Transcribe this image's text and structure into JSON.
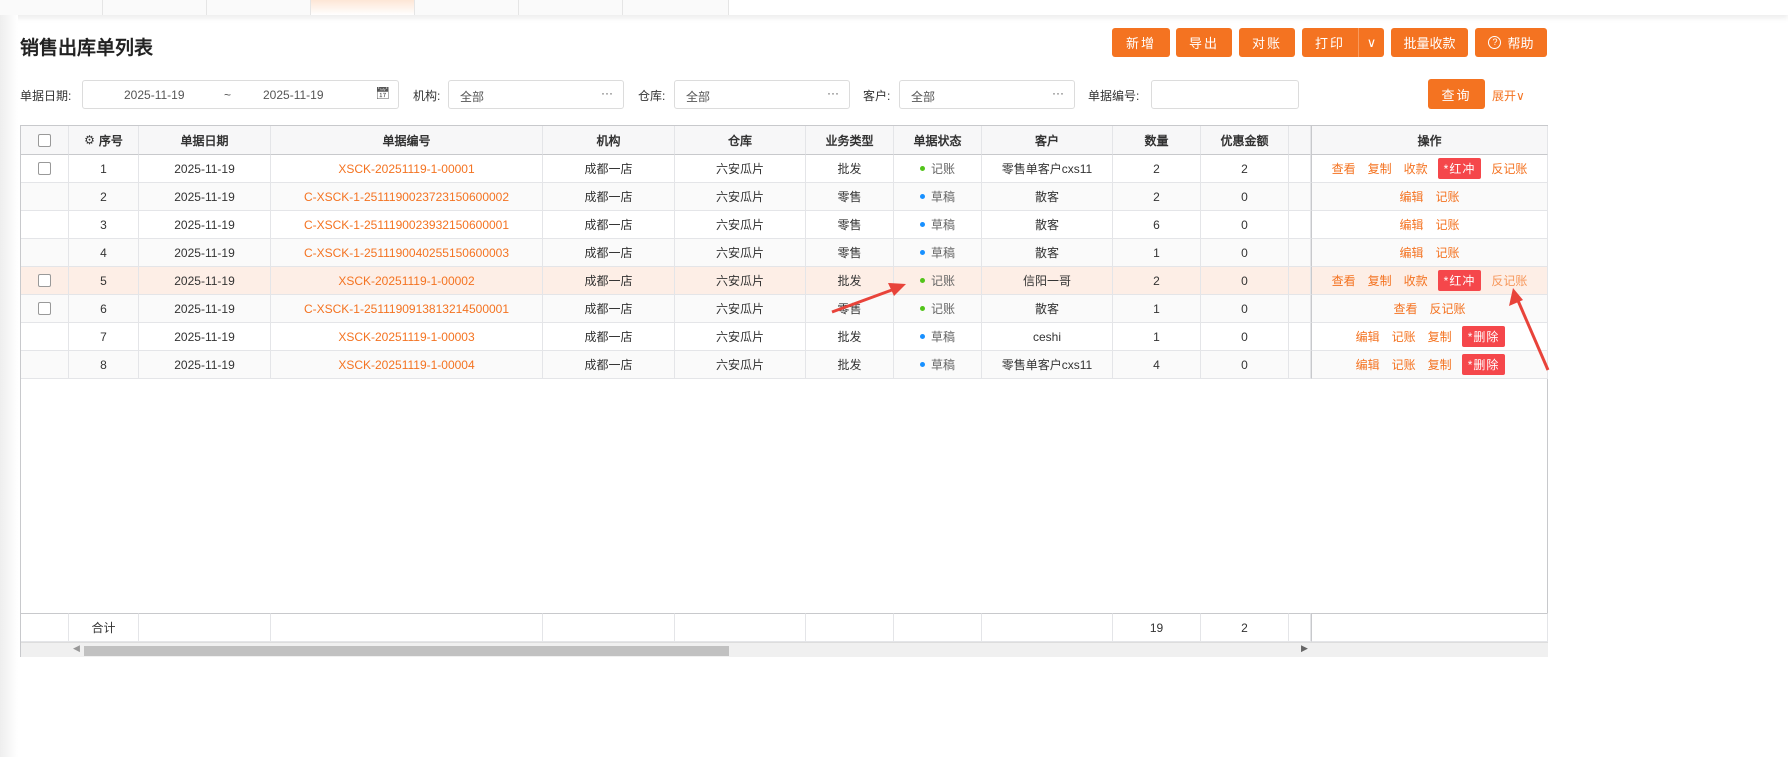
{
  "page": {
    "title": "销售出库单列表"
  },
  "toolbar": {
    "add": "新增",
    "export": "导出",
    "reconcile": "对账",
    "print": "打印",
    "batch_collect": "批量收款",
    "help": "帮助"
  },
  "filters": {
    "date_label": "单据日期:",
    "date_from": "2025-11-19",
    "date_sep": "~",
    "date_to": "2025-11-19",
    "org_label": "机构:",
    "org_value": "全部",
    "warehouse_label": "仓库:",
    "warehouse_value": "全部",
    "customer_label": "客户:",
    "customer_value": "全部",
    "docno_label": "单据编号:",
    "docno_value": "",
    "query": "查询",
    "expand": "展开"
  },
  "table": {
    "columns": [
      "序号",
      "单据日期",
      "单据编号",
      "机构",
      "仓库",
      "业务类型",
      "单据状态",
      "客户",
      "数量",
      "优惠金额",
      "",
      "操作"
    ],
    "rows": [
      {
        "seq": "1",
        "date": "2025-11-19",
        "no": "XSCK-20251119-1-00001",
        "org": "成都一店",
        "wh": "六安瓜片",
        "type": "批发",
        "status": "记账",
        "customer": "零售单客户cxs11",
        "qty": "2",
        "disc": "2",
        "check": true,
        "ops": [
          "查看",
          "复制",
          "收款",
          "*红冲",
          "反记账"
        ]
      },
      {
        "seq": "2",
        "date": "2025-11-19",
        "no": "C-XSCK-1-2511190023723150600002",
        "org": "成都一店",
        "wh": "六安瓜片",
        "type": "零售",
        "status": "草稿",
        "customer": "散客",
        "qty": "2",
        "disc": "0",
        "check": false,
        "ops": [
          "编辑",
          "记账"
        ]
      },
      {
        "seq": "3",
        "date": "2025-11-19",
        "no": "C-XSCK-1-2511190023932150600001",
        "org": "成都一店",
        "wh": "六安瓜片",
        "type": "零售",
        "status": "草稿",
        "customer": "散客",
        "qty": "6",
        "disc": "0",
        "check": false,
        "ops": [
          "编辑",
          "记账"
        ]
      },
      {
        "seq": "4",
        "date": "2025-11-19",
        "no": "C-XSCK-1-2511190040255150600003",
        "org": "成都一店",
        "wh": "六安瓜片",
        "type": "零售",
        "status": "草稿",
        "customer": "散客",
        "qty": "1",
        "disc": "0",
        "check": false,
        "ops": [
          "编辑",
          "记账"
        ]
      },
      {
        "seq": "5",
        "date": "2025-11-19",
        "no": "XSCK-20251119-1-00002",
        "org": "成都一店",
        "wh": "六安瓜片",
        "type": "批发",
        "status": "记账",
        "customer": "信阳一哥",
        "qty": "2",
        "disc": "0",
        "check": true,
        "selected": true,
        "ops": [
          "查看",
          "复制",
          "收款",
          "*红冲",
          "反记账"
        ]
      },
      {
        "seq": "6",
        "date": "2025-11-19",
        "no": "C-XSCK-1-2511190913813214500001",
        "org": "成都一店",
        "wh": "六安瓜片",
        "type": "零售",
        "status": "记账",
        "customer": "散客",
        "qty": "1",
        "disc": "0",
        "check": true,
        "ops": [
          "查看",
          "反记账"
        ]
      },
      {
        "seq": "7",
        "date": "2025-11-19",
        "no": "XSCK-20251119-1-00003",
        "org": "成都一店",
        "wh": "六安瓜片",
        "type": "批发",
        "status": "草稿",
        "customer": "ceshi",
        "qty": "1",
        "disc": "0",
        "check": false,
        "ops": [
          "编辑",
          "记账",
          "复制",
          "*删除"
        ]
      },
      {
        "seq": "8",
        "date": "2025-11-19",
        "no": "XSCK-20251119-1-00004",
        "org": "成都一店",
        "wh": "六安瓜片",
        "type": "批发",
        "status": "草稿",
        "customer": "零售单客户cxs11",
        "qty": "4",
        "disc": "0",
        "check": false,
        "ops": [
          "编辑",
          "记账",
          "复制",
          "*删除"
        ]
      }
    ],
    "footer": {
      "label": "合计",
      "qty": "19",
      "disc": "2"
    }
  },
  "colors": {
    "accent": "#f47321",
    "danger": "#f5474b",
    "posted": "#52c41a",
    "draft": "#1890ff",
    "selected_row": "#fdeee6"
  }
}
